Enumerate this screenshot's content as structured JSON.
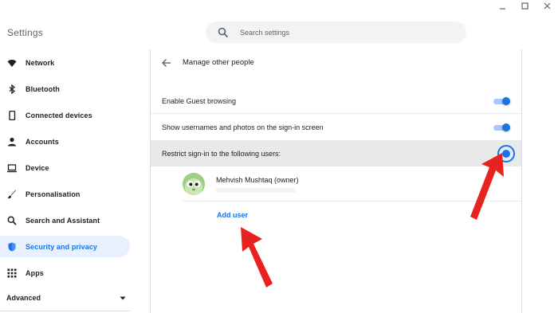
{
  "app": {
    "title": "Settings"
  },
  "search": {
    "placeholder": "Search settings"
  },
  "sidebar": {
    "items": [
      {
        "label": "Network",
        "icon": "wifi-icon"
      },
      {
        "label": "Bluetooth",
        "icon": "bluetooth-icon"
      },
      {
        "label": "Connected devices",
        "icon": "phone-icon"
      },
      {
        "label": "Accounts",
        "icon": "person-icon"
      },
      {
        "label": "Device",
        "icon": "laptop-icon"
      },
      {
        "label": "Personalisation",
        "icon": "brush-icon"
      },
      {
        "label": "Search and Assistant",
        "icon": "search-icon"
      },
      {
        "label": "Security and privacy",
        "icon": "shield-icon",
        "active": true
      },
      {
        "label": "Apps",
        "icon": "grid-icon"
      }
    ],
    "advanced_label": "Advanced"
  },
  "page": {
    "title": "Manage other people",
    "settings": [
      {
        "label": "Enable Guest browsing",
        "enabled": true
      },
      {
        "label": "Show usernames and photos on the sign-in screen",
        "enabled": true
      },
      {
        "label": "Restrict sign-in to the following users:",
        "enabled": true
      }
    ],
    "user": {
      "name": "Mehvish Mushtaq (owner)"
    },
    "add_user_label": "Add user"
  },
  "colors": {
    "accent": "#1a73e8",
    "active_bg": "#e8f0fe",
    "highlight_row": "#e8e9eb",
    "annotation_arrow": "#e8231f"
  }
}
